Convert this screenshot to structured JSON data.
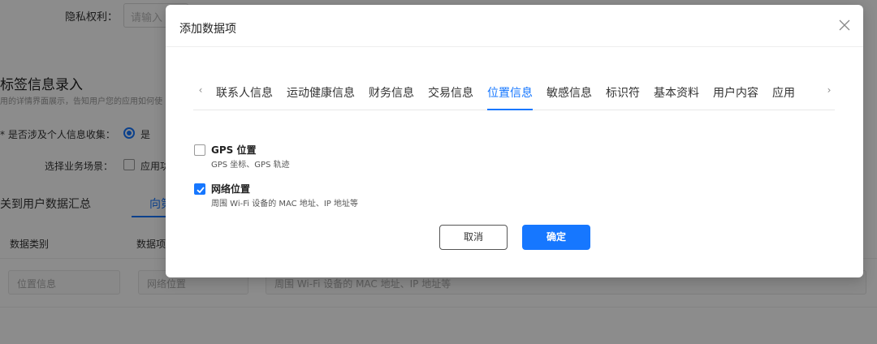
{
  "background": {
    "privacy_label": "隐私权利：",
    "privacy_placeholder": "请输入",
    "section_title": "标签信息录入",
    "section_desc": "用的详情界面展示，告知用户您的应用如何使",
    "question1": "* 是否涉及个人信息收集：",
    "question1_answer": "是",
    "question2": "选择业务场景：",
    "question2_option": "应用功",
    "tab_a": "关到用户数据汇总",
    "tab_b": "向第",
    "col_category": "数据类别",
    "col_item": "数据项",
    "cell_category": "位置信息",
    "cell_item": "网络位置",
    "cell_desc": "周围 Wi-Fi 设备的 MAC 地址、IP 地址等"
  },
  "dialog": {
    "title": "添加数据项",
    "tabs": [
      "联系人信息",
      "运动健康信息",
      "财务信息",
      "交易信息",
      "位置信息",
      "敏感信息",
      "标识符",
      "基本资料",
      "用户内容",
      "应用"
    ],
    "active_tab": "位置信息",
    "options": [
      {
        "title": "GPS 位置",
        "desc": "GPS 坐标、GPS 轨迹",
        "checked": false
      },
      {
        "title": "网络位置",
        "desc": "周围 Wi-Fi 设备的 MAC 地址、IP 地址等",
        "checked": true
      }
    ],
    "cancel_label": "取消",
    "ok_label": "确定"
  },
  "colors": {
    "accent": "#1677ff"
  },
  "icons": {
    "close": "close-icon",
    "prev": "chevron-left-icon",
    "next": "chevron-right-icon",
    "check": "check-icon"
  }
}
